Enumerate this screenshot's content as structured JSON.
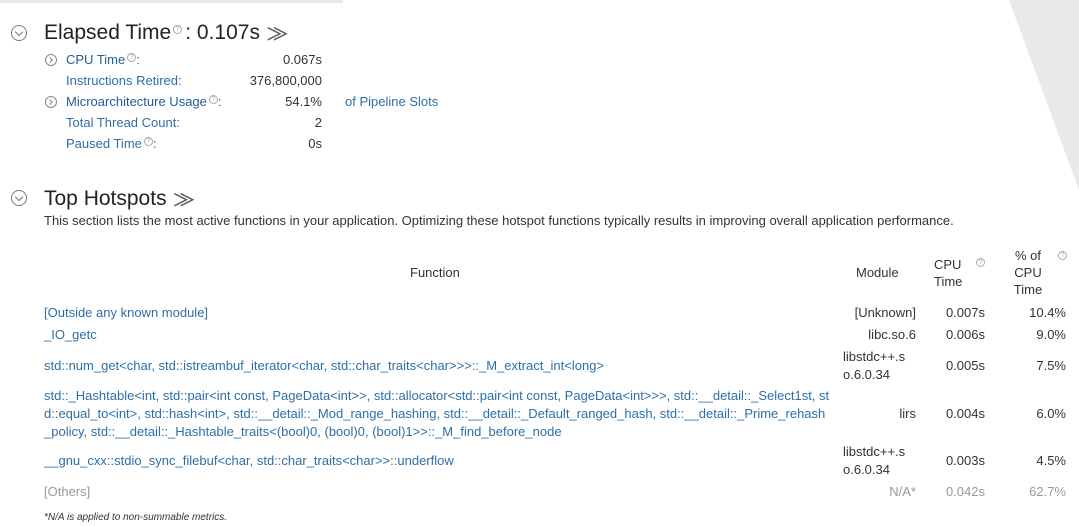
{
  "elapsed": {
    "title": "Elapsed Time",
    "value": "0.107s",
    "metrics": {
      "cpu_time": {
        "label": "CPU Time",
        "value": "0.067s"
      },
      "instructions_retired": {
        "label": "Instructions Retired:",
        "value": "376,800,000"
      },
      "microarch_usage": {
        "label": "Microarchitecture Usage",
        "value": "54.1%",
        "unit": "of Pipeline Slots"
      },
      "total_thread_count": {
        "label": "Total Thread Count:",
        "value": "2"
      },
      "paused_time": {
        "label": "Paused Time",
        "value": "0s"
      }
    }
  },
  "hotspots": {
    "title": "Top Hotspots",
    "description": "This section lists the most active functions in your application. Optimizing these hotspot functions typically results in improving overall application performance.",
    "columns": {
      "function": "Function",
      "module": "Module",
      "cpu_time": "CPU Time",
      "pct_cpu_time": "% of CPU Time"
    },
    "rows": [
      {
        "function": "[Outside any known module]",
        "module": "[Unknown]",
        "cpu_time": "0.007s",
        "pct": "10.4%"
      },
      {
        "function": "_IO_getc",
        "module": "libc.so.6",
        "cpu_time": "0.006s",
        "pct": "9.0%"
      },
      {
        "function": "std::num_get<char, std::istreambuf_iterator<char, std::char_traits<char>>>::_M_extract_int<long>",
        "module": "libstdc++.so.6.0.34",
        "cpu_time": "0.005s",
        "pct": "7.5%"
      },
      {
        "function": "std::_Hashtable<int, std::pair<int const, PageData<int>>, std::allocator<std::pair<int const, PageData<int>>>, std::__detail::_Select1st, std::equal_to<int>, std::hash<int>, std::__detail::_Mod_range_hashing, std::__detail::_Default_ranged_hash, std::__detail::_Prime_rehash_policy, std::__detail::_Hashtable_traits<(bool)0, (bool)0, (bool)1>>::_M_find_before_node",
        "module": "lirs",
        "cpu_time": "0.004s",
        "pct": "6.0%"
      },
      {
        "function": "__gnu_cxx::stdio_sync_filebuf<char, std::char_traits<char>>::underflow",
        "module": "libstdc++.so.6.0.34",
        "cpu_time": "0.003s",
        "pct": "4.5%"
      },
      {
        "function": "[Others]",
        "module": "N/A*",
        "cpu_time": "0.042s",
        "pct": "62.7%"
      }
    ],
    "footnote": "*N/A is applied to non-summable metrics."
  },
  "icons": {
    "collapse": "chevron-circle-down-icon",
    "expand": "chevron-circle-right-icon",
    "help": "question-circle-icon",
    "prompt": "terminal-prompt-icon"
  },
  "colors": {
    "link": "#2e6fa7",
    "muted": "#999999",
    "text": "#333333"
  }
}
